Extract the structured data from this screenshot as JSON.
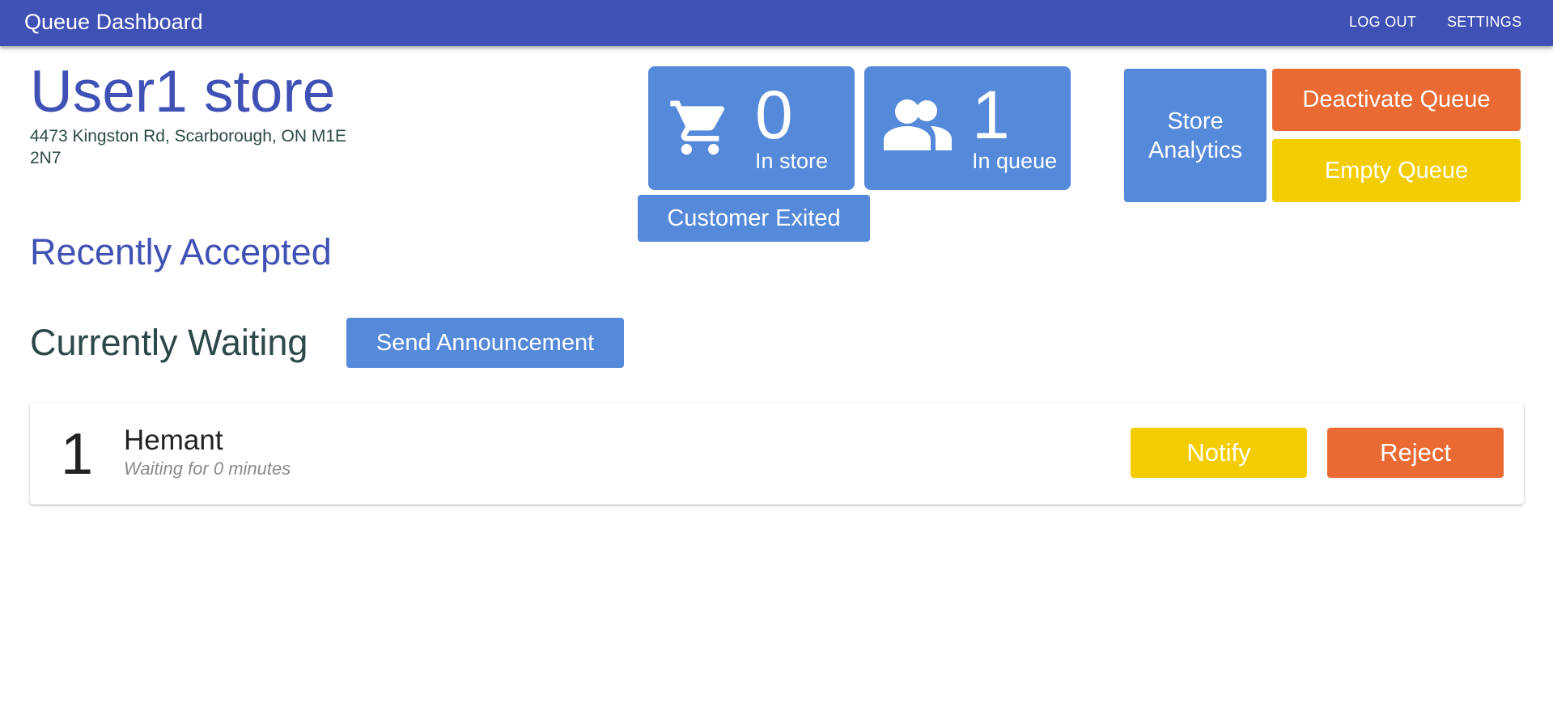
{
  "header": {
    "title": "Queue Dashboard",
    "logout_label": "LOG OUT",
    "settings_label": "SETTINGS"
  },
  "store": {
    "name": "User1 store",
    "address": "4473 Kingston Rd, Scarborough, ON M1E 2N7"
  },
  "stats": {
    "in_store": {
      "icon": "cart-icon",
      "value": "0",
      "label": "In store"
    },
    "in_queue": {
      "icon": "people-icon",
      "value": "1",
      "label": "In queue"
    }
  },
  "actions": {
    "customer_exited": "Customer Exited",
    "store_analytics": "Store Analytics",
    "deactivate_queue": "Deactivate Queue",
    "empty_queue": "Empty Queue"
  },
  "sections": {
    "recently_accepted": "Recently Accepted",
    "currently_waiting": "Currently Waiting",
    "send_announcement": "Send Announcement"
  },
  "queue": [
    {
      "position": "1",
      "name": "Hemant",
      "wait": "Waiting for 0 minutes",
      "notify_label": "Notify",
      "reject_label": "Reject"
    }
  ],
  "colors": {
    "primary": "#3f51b5",
    "tile_blue": "#5589d9",
    "orange": "#e96a33",
    "yellow": "#f3cd00",
    "dark_text": "#2c4848"
  }
}
